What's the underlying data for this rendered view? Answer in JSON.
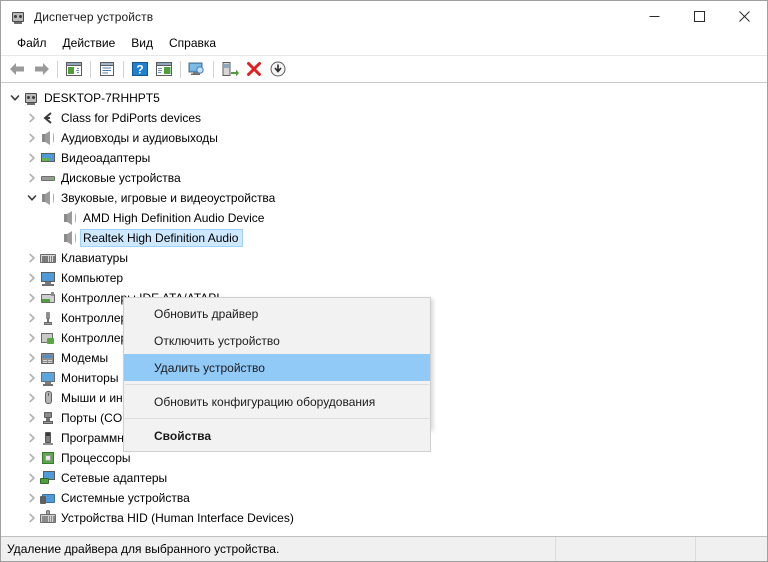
{
  "window": {
    "title": "Диспетчер устройств",
    "icon": "device-manager-icon",
    "minimize_label": "—",
    "maximize_label": "□",
    "close_label": "✕"
  },
  "menubar": {
    "items": [
      {
        "label": "Файл",
        "name": "menubar-item-file"
      },
      {
        "label": "Действие",
        "name": "menubar-item-action"
      },
      {
        "label": "Вид",
        "name": "menubar-item-view"
      },
      {
        "label": "Справка",
        "name": "menubar-item-help"
      }
    ]
  },
  "toolbar": {
    "buttons": [
      {
        "icon": "back-arrow-icon",
        "title": "Назад"
      },
      {
        "icon": "forward-arrow-icon",
        "title": "Вперёд"
      },
      {
        "icon": "show-hide-console-tree-icon",
        "title": "Показать/скрыть дерево консоли"
      },
      {
        "icon": "properties-icon",
        "title": "Свойства"
      },
      {
        "icon": "help-icon",
        "title": "Справка"
      },
      {
        "icon": "show-hide-action-pane-icon",
        "title": "Показать/скрыть панель действий"
      },
      {
        "icon": "scan-hardware-changes-icon",
        "title": "Обновить конфигурацию оборудования"
      },
      {
        "icon": "update-driver-icon",
        "title": "Обновить драйвер"
      },
      {
        "icon": "uninstall-device-icon",
        "title": "Удалить устройство"
      },
      {
        "icon": "disable-device-icon",
        "title": "Отключить устройство"
      }
    ]
  },
  "tree": {
    "rows": [
      {
        "level": 0,
        "twisty": "expanded",
        "icon": "computer-node-icon",
        "label": "DESKTOP-7RHHPT5",
        "selected": false
      },
      {
        "level": 1,
        "twisty": "collapsed",
        "icon": "pdiports-class-icon",
        "label": "Class for PdiPorts devices",
        "selected": false
      },
      {
        "level": 1,
        "twisty": "collapsed",
        "icon": "speaker-icon",
        "label": "Аудиовходы и аудиовыходы",
        "selected": false
      },
      {
        "level": 1,
        "twisty": "collapsed",
        "icon": "video-adapter-icon",
        "label": "Видеоадаптеры",
        "selected": false
      },
      {
        "level": 1,
        "twisty": "collapsed",
        "icon": "disk-drive-icon",
        "label": "Дисковые устройства",
        "selected": false
      },
      {
        "level": 1,
        "twisty": "expanded",
        "icon": "speaker-icon",
        "label": "Звуковые, игровые и видеоустройства",
        "selected": false
      },
      {
        "level": 2,
        "twisty": "none",
        "icon": "speaker-icon",
        "label": "AMD High Definition Audio Device",
        "selected": false
      },
      {
        "level": 2,
        "twisty": "none",
        "icon": "speaker-icon",
        "label": "Realtek High Definition Audio",
        "selected": true
      },
      {
        "level": 1,
        "twisty": "collapsed",
        "icon": "keyboard-icon",
        "label": "Клавиатуры",
        "selected": false
      },
      {
        "level": 1,
        "twisty": "collapsed",
        "icon": "computer-icon",
        "label": "Компьютер",
        "selected": false
      },
      {
        "level": 1,
        "twisty": "collapsed",
        "icon": "ide-controller-icon",
        "label": "Контроллеры IDE ATA/ATAPI",
        "selected": false
      },
      {
        "level": 1,
        "twisty": "collapsed",
        "icon": "usb-controller-icon",
        "label": "Контроллеры USB",
        "selected": false
      },
      {
        "level": 1,
        "twisty": "collapsed",
        "icon": "storage-controller-icon",
        "label": "Контроллеры запоминающих устройств",
        "selected": false
      },
      {
        "level": 1,
        "twisty": "collapsed",
        "icon": "modem-icon",
        "label": "Модемы",
        "selected": false
      },
      {
        "level": 1,
        "twisty": "collapsed",
        "icon": "monitor-icon",
        "label": "Мониторы",
        "selected": false
      },
      {
        "level": 1,
        "twisty": "collapsed",
        "icon": "mouse-icon",
        "label": "Мыши и иные указывающие устройства",
        "selected": false
      },
      {
        "level": 1,
        "twisty": "collapsed",
        "icon": "port-icon",
        "label": "Порты (COM и LPT)",
        "selected": false
      },
      {
        "level": 1,
        "twisty": "collapsed",
        "icon": "software-device-icon",
        "label": "Программные устройства",
        "selected": false
      },
      {
        "level": 1,
        "twisty": "collapsed",
        "icon": "processor-icon",
        "label": "Процессоры",
        "selected": false
      },
      {
        "level": 1,
        "twisty": "collapsed",
        "icon": "network-adapter-icon",
        "label": "Сетевые адаптеры",
        "selected": false
      },
      {
        "level": 1,
        "twisty": "collapsed",
        "icon": "system-device-icon",
        "label": "Системные устройства",
        "selected": false
      },
      {
        "level": 1,
        "twisty": "collapsed",
        "icon": "hid-device-icon",
        "label": "Устройства HID (Human Interface Devices)",
        "selected": false
      }
    ]
  },
  "context_menu": {
    "items": [
      {
        "label": "Обновить драйвер",
        "name": "context-menu-item-update-driver",
        "highlight": false,
        "bold": false,
        "separator_after": false
      },
      {
        "label": "Отключить устройство",
        "name": "context-menu-item-disable-device",
        "highlight": false,
        "bold": false,
        "separator_after": false
      },
      {
        "label": "Удалить устройство",
        "name": "context-menu-item-uninstall-device",
        "highlight": true,
        "bold": false,
        "separator_after": true
      },
      {
        "label": "Обновить конфигурацию оборудования",
        "name": "context-menu-item-scan-hardware",
        "highlight": false,
        "bold": false,
        "separator_after": true
      },
      {
        "label": "Свойства",
        "name": "context-menu-item-properties",
        "highlight": false,
        "bold": true,
        "separator_after": false
      }
    ]
  },
  "statusbar": {
    "message": "Удаление драйвера для выбранного устройства.",
    "panel2": "",
    "panel3": ""
  },
  "colors": {
    "selection_blue": "#cde8ff",
    "menu_highlight": "#91c9f7",
    "menu_bg": "#f2f2f2",
    "status_bg": "#f0f0f0",
    "window_border": "#a0a0a0"
  }
}
